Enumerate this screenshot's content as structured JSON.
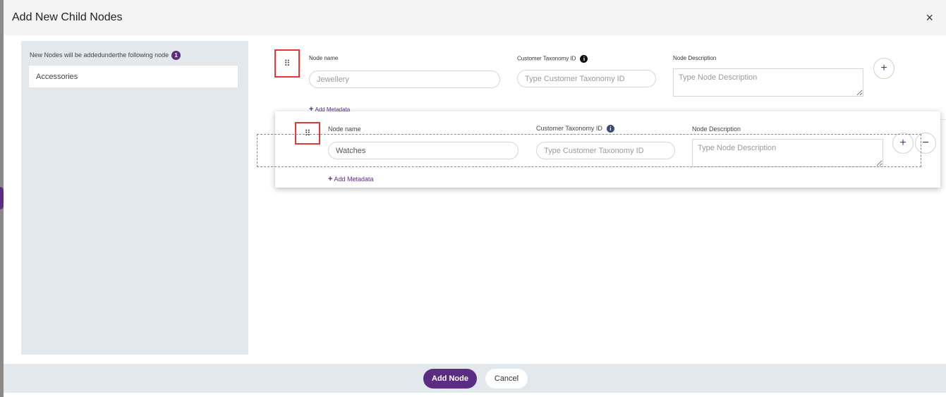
{
  "dialog": {
    "title": "Add New Child Nodes",
    "close_icon": "×"
  },
  "parent": {
    "label": "New Nodes will be addedunderthe following node",
    "count": "1",
    "name": "Accessories"
  },
  "icons": {
    "drag": "⠿",
    "info": "i",
    "plus": "+",
    "minus": "−"
  },
  "node1": {
    "name_label": "Node name",
    "name_placeholder": "Jewellery",
    "taxonomy_label": "Customer Taxonomy ID",
    "taxonomy_placeholder": "Type Customer Taxonomy ID",
    "desc_label": "Node Description",
    "desc_placeholder": "Type Node Description",
    "add_metadata": "Add Metadata"
  },
  "node2": {
    "name_label": "Node name",
    "name_value": "Watches",
    "taxonomy_label": "Customer Taxonomy ID",
    "taxonomy_placeholder": "Type Customer Taxonomy ID",
    "desc_label": "Node Description",
    "desc_placeholder": "Type Node Description",
    "add_metadata": "Add Metadata"
  },
  "footer": {
    "add_node": "Add Node",
    "cancel": "Cancel"
  },
  "colors": {
    "accent": "#5a2d82",
    "panel": "#e2e8ec",
    "header": "#f4f4f4",
    "highlight": "#e53935"
  }
}
